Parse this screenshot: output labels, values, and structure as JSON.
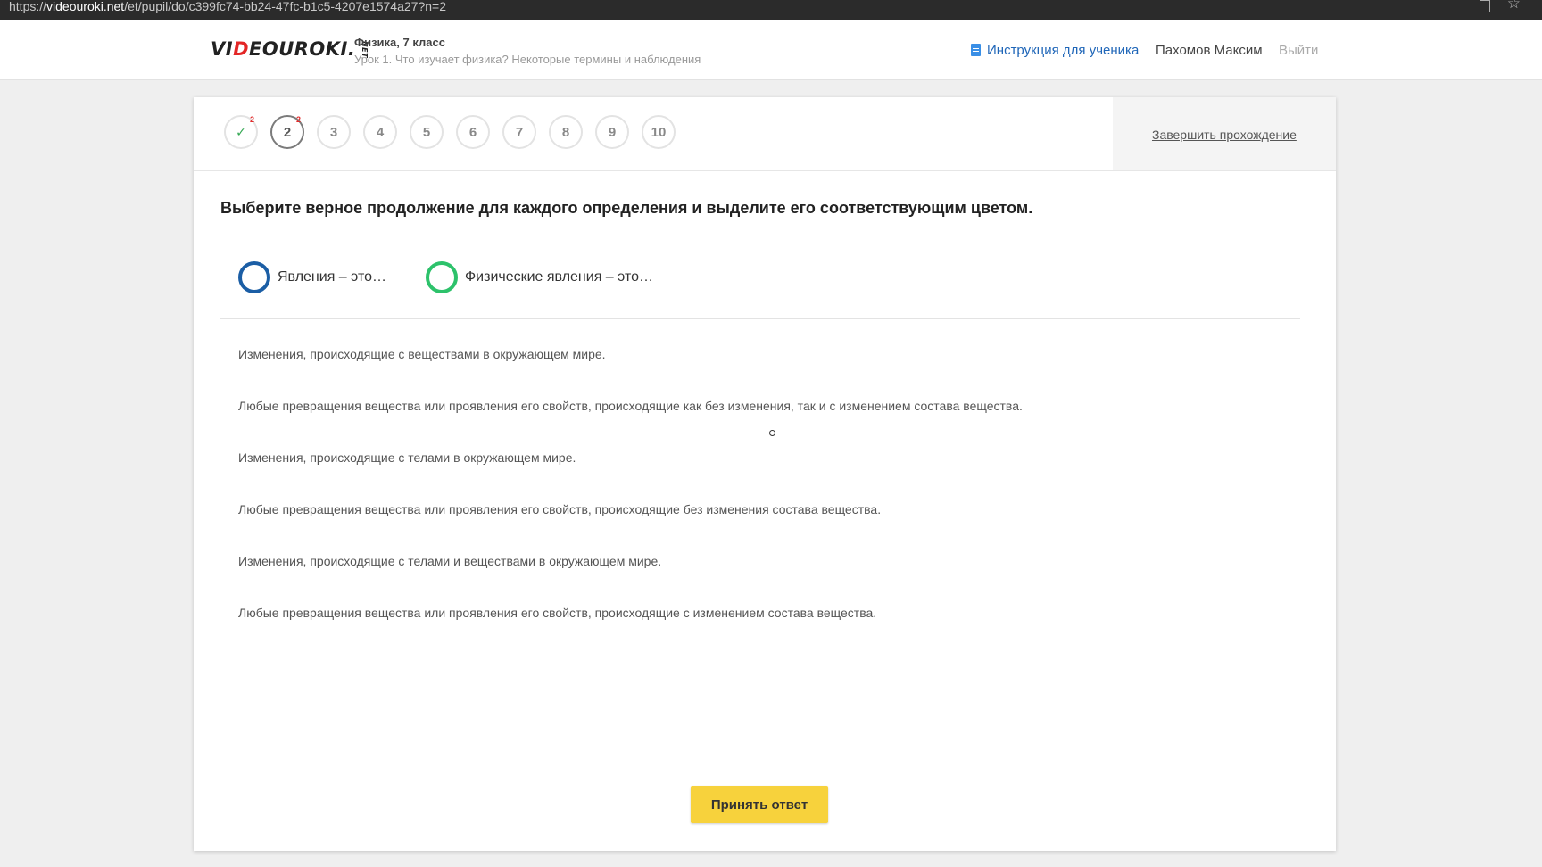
{
  "browser": {
    "url_prefix": "https://",
    "url_host": "videouroki.net",
    "url_path": "/et/pupil/do/c399fc74-bb24-47fc-b1c5-4207e1574a27?n=2"
  },
  "header": {
    "logo_pre": "VI",
    "logo_d": "D",
    "logo_post": "EOUROKI.",
    "logo_net": "NET",
    "course_title": "Физика, 7 класс",
    "lesson_title": "Урок 1. Что изучает физика? Некоторые термины и наблюдения",
    "instructions_link": "Инструкция для ученика",
    "user_name": "Пахомов Максим",
    "logout": "Выйти"
  },
  "steps": [
    {
      "label": "",
      "state": "done",
      "badge": "2"
    },
    {
      "label": "2",
      "state": "current",
      "badge": "2"
    },
    {
      "label": "3",
      "state": "",
      "badge": ""
    },
    {
      "label": "4",
      "state": "",
      "badge": ""
    },
    {
      "label": "5",
      "state": "",
      "badge": ""
    },
    {
      "label": "6",
      "state": "",
      "badge": ""
    },
    {
      "label": "7",
      "state": "",
      "badge": ""
    },
    {
      "label": "8",
      "state": "",
      "badge": ""
    },
    {
      "label": "9",
      "state": "",
      "badge": ""
    },
    {
      "label": "10",
      "state": "",
      "badge": ""
    }
  ],
  "finish_link": "Завершить прохождение",
  "question": "Выберите верное продолжение для каждого определения и выделите его соответствующим цветом.",
  "legend": [
    {
      "label": "Явления – это…",
      "color": "#1b5ea5"
    },
    {
      "label": "Физические явления – это…",
      "color": "#2dc26b"
    }
  ],
  "options": [
    "Изменения, происходящие с веществами в окружающем мире.",
    "Любые превращения вещества или проявления его свойств, происходящие как без изменения, так и с изменением состава вещества.",
    "Изменения, происходящие с телами в окружающем мире.",
    "Любые превращения вещества или проявления его свойств, происходящие без изменения состава вещества.",
    "Изменения, происходящие с телами и веществами в окружающем мире.",
    "Любые превращения вещества или проявления его свойств, происходящие с изменением состава вещества."
  ],
  "submit_label": "Принять ответ",
  "colors": {
    "accent": "#f7d23c",
    "link": "#1f66b8",
    "badge": "#e02b2b"
  }
}
